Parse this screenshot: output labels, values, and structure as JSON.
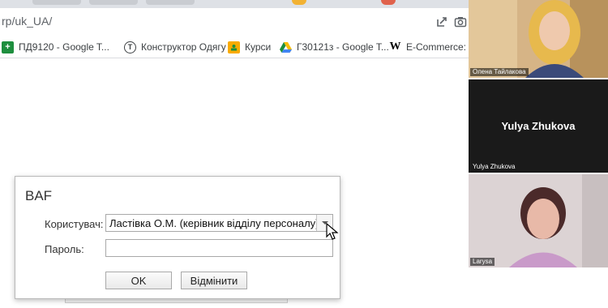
{
  "browser": {
    "url_fragment": "rp/uk_UA/",
    "bookmarks": [
      {
        "label": "ПД9120 - Google T...",
        "icon": "plus-square-icon",
        "color": "#1e8e3e"
      },
      {
        "label": "Конструктор Одягу",
        "icon": "circle-t-icon",
        "color": "#3c4043"
      },
      {
        "label": "Курси",
        "icon": "classroom-icon",
        "color": "#f9ab00"
      },
      {
        "label": "Г30121з - Google T...",
        "icon": "drive-icon",
        "color": "#1a73e8"
      },
      {
        "label": "E-Commerce: щ",
        "icon": "w-icon",
        "color": "#000000"
      }
    ]
  },
  "dialog": {
    "title": "BAF",
    "user_label": "Користувач:",
    "user_value": "Ластівка О.М. (керівник відділу персоналу)",
    "password_label": "Пароль:",
    "password_value": "",
    "ok_label": "OK",
    "cancel_label": "Відмінити"
  },
  "participants": [
    {
      "name": "Олена Тайлакова",
      "type": "video",
      "bg": "#c9a36e"
    },
    {
      "name": "Yulya Zhukova",
      "type": "placeholder",
      "display_name": "Yulya Zhukova",
      "bg": "#1a1a1a"
    },
    {
      "name": "Larysa",
      "type": "video",
      "bg": "#d8cfd2"
    }
  ]
}
